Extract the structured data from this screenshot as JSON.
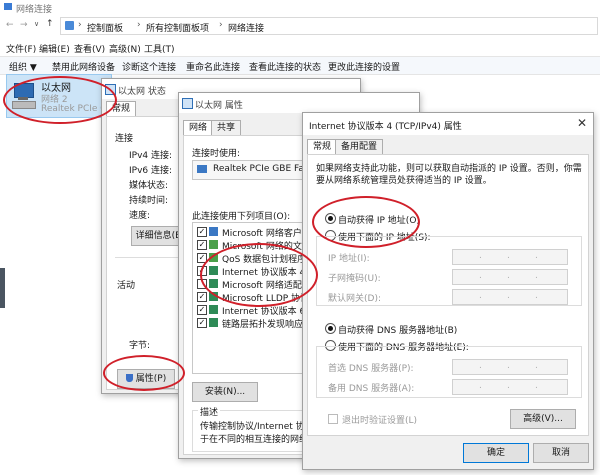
{
  "explorer": {
    "title": "网络连接",
    "breadcrumb": [
      "控制面板",
      "所有控制面板项",
      "网络连接"
    ],
    "menu": [
      "文件(F)",
      "编辑(E)",
      "查看(V)",
      "高级(N)",
      "工具(T)"
    ],
    "toolbar": [
      "组织 ▼",
      "禁用此网络设备",
      "诊断这个连接",
      "重命名此连接",
      "查看此连接的状态",
      "更改此连接的设置"
    ],
    "adapter": {
      "name": "以太网",
      "network": "网络 2",
      "device": "Realtek PCIe GBE"
    }
  },
  "status_dialog": {
    "title": "以太网 状态",
    "tab": "常规",
    "section_connection": "连接",
    "fields": [
      "IPv4 连接:",
      "IPv6 连接:",
      "媒体状态:",
      "持续时间:",
      "速度:"
    ],
    "details_button": "详细信息(E)",
    "section_activity": "活动",
    "bytes_label": "字节:",
    "properties_button": "属性(P)"
  },
  "props_dialog": {
    "title": "以太网 属性",
    "tabs": [
      "网络",
      "共享"
    ],
    "connect_using_label": "连接时使用:",
    "adapter_name": "Realtek PCIe GBE Family",
    "items_label": "此连接使用下列项目(O):",
    "items": [
      {
        "label": "Microsoft 网络客户端",
        "checked": true
      },
      {
        "label": "Microsoft 网络的文件和",
        "checked": true
      },
      {
        "label": "QoS 数据包计划程序",
        "checked": true
      },
      {
        "label": "Internet 协议版本 4 (TCP",
        "checked": true
      },
      {
        "label": "Microsoft 网络适配器多",
        "checked": false
      },
      {
        "label": "Microsoft LLDP 协议驱动",
        "checked": true
      },
      {
        "label": "Internet 协议版本 6 (TC",
        "checked": true
      },
      {
        "label": "链路层拓扑发现响应程序",
        "checked": true
      }
    ],
    "install_button": "安装(N)...",
    "description_label": "描述",
    "description_text": "传输控制协议/Internet 协议。",
    "description_text2": "于在不同的相互连接的网络上"
  },
  "ipv4_dialog": {
    "title": "Internet 协议版本 4 (TCP/IPv4) 属性",
    "tabs": [
      "常规",
      "备用配置"
    ],
    "intro": "如果网络支持此功能，则可以获取自动指派的 IP 设置。否则，你需要从网络系统管理员处获得适当的 IP 设置。",
    "auto_ip": "自动获得 IP 地址(O)",
    "manual_ip": "使用下面的 IP 地址(S):",
    "ip_address": "IP 地址(I):",
    "subnet_mask": "子网掩码(U):",
    "gateway": "默认网关(D):",
    "auto_dns": "自动获得 DNS 服务器地址(B)",
    "manual_dns": "使用下面的 DNS 服务器地址(E):",
    "preferred_dns": "首选 DNS 服务器(P):",
    "alternate_dns": "备用 DNS 服务器(A):",
    "validate_on_exit": "退出时验证设置(L)",
    "advanced_button": "高级(V)...",
    "ok_button": "确定",
    "cancel_button": "取消",
    "selected_ip_mode": "auto",
    "selected_dns_mode": "auto"
  },
  "annotation_color": "#d0202a"
}
